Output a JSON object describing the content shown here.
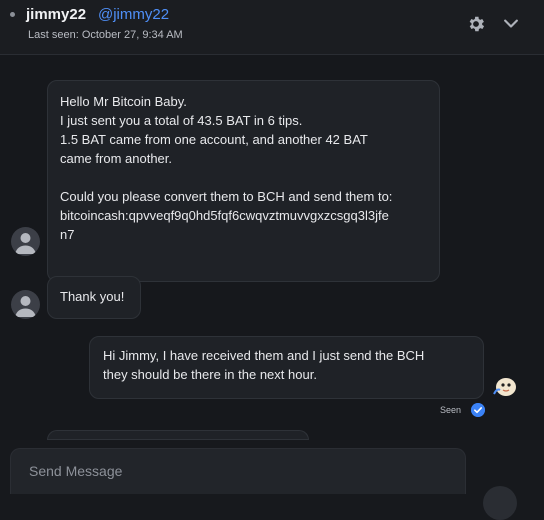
{
  "header": {
    "username": "jimmy22",
    "handle": "@jimmy22",
    "last_seen": "Last seen: October 27, 9:34 AM"
  },
  "messages": [
    {
      "lines": [
        "Hello Mr Bitcoin Baby.",
        "I just sent you a total of 43.5 BAT in 6 tips.",
        "1.5 BAT came from one account, and another 42 BAT",
        "came from another.",
        "",
        "Could you please convert them to BCH and send them to:",
        "bitcoincash:qpvveqf9q0hd5fqf6cwqvztmuvvgxzcsgq3l3jfe",
        "n7"
      ]
    },
    {
      "lines": [
        "Thank you!"
      ]
    },
    {
      "lines": [
        "Hi Jimmy, I have received them and I just send the BCH",
        "they should be there in the next hour."
      ]
    }
  ],
  "seen_label": "Seen",
  "composer": {
    "placeholder": "Send Message"
  },
  "icons": {
    "settings": "gear-icon",
    "collapse": "chevron-down-icon",
    "avatar": "user-avatar-icon",
    "seen": "check-circle-icon"
  },
  "colors": {
    "accent": "#4f8ff7",
    "background": "#16181c",
    "bubble": "#1f2227"
  }
}
